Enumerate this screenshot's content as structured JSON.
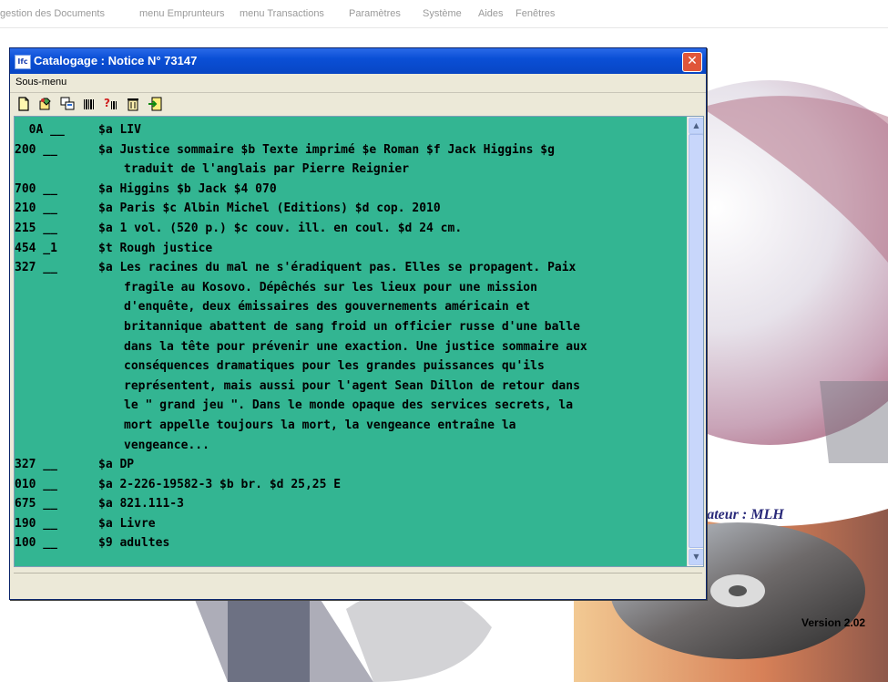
{
  "app_menu": [
    "gestion des Documents",
    "menu Emprunteurs",
    "menu Transactions",
    "Paramètres",
    "Système",
    "Aides",
    "Fenêtres"
  ],
  "window": {
    "icon_text": "Ifc",
    "title": "Catalogage : Notice N° 73147",
    "close": "✕",
    "submenu": "Sous-menu"
  },
  "toolbar": [
    {
      "icon": "new-page-icon"
    },
    {
      "icon": "edit-record-icon"
    },
    {
      "icon": "copy-record-icon"
    },
    {
      "icon": "barcode-icon"
    },
    {
      "icon": "barcode-help-icon"
    },
    {
      "icon": "delete-icon"
    },
    {
      "icon": "exit-icon"
    }
  ],
  "record": [
    {
      "tag": "  0A __ ",
      "lines": [
        "$a LIV"
      ]
    },
    {
      "tag": "200 __ ",
      "lines": [
        "$a Justice sommaire $b Texte imprimé $e Roman $f Jack Higgins $g",
        "traduit de l'anglais par Pierre Reignier"
      ]
    },
    {
      "tag": "700 __ ",
      "lines": [
        "$a Higgins $b Jack $4 070"
      ]
    },
    {
      "tag": "210 __ ",
      "lines": [
        "$a Paris $c Albin Michel (Editions) $d cop. 2010"
      ]
    },
    {
      "tag": "215 __ ",
      "lines": [
        "$a 1 vol. (520 p.) $c couv. ill. en coul. $d 24 cm."
      ]
    },
    {
      "tag": "454 _1 ",
      "lines": [
        "$t Rough justice"
      ]
    },
    {
      "tag": "327 __ ",
      "lines": [
        "$a Les racines du mal ne s'éradiquent pas. Elles se propagent. Paix",
        "fragile au Kosovo. Dépêchés sur les lieux pour une mission",
        "d'enquête, deux émissaires des gouvernements américain et",
        "britannique abattent de sang froid un officier russe d'une balle",
        "dans la tête pour prévenir une exaction. Une justice sommaire aux",
        "conséquences dramatiques pour les grandes puissances qu'ils",
        "représentent, mais aussi pour l'agent Sean Dillon de retour dans",
        "le \" grand jeu \". Dans le monde opaque des services secrets, la",
        "mort appelle toujours la mort, la vengeance entraîne la",
        "vengeance..."
      ]
    },
    {
      "tag": "327 __ ",
      "lines": [
        "$a DP"
      ]
    },
    {
      "tag": "010 __ ",
      "lines": [
        "$a 2-226-19582-3 $b br. $d 25,25 E"
      ]
    },
    {
      "tag": "675 __ ",
      "lines": [
        "$a 821.111-3"
      ]
    },
    {
      "tag": "190 __ ",
      "lines": [
        "$a Livre"
      ]
    },
    {
      "tag": "100 __ ",
      "lines": [
        "$9 adultes"
      ]
    }
  ],
  "background": {
    "user_label": "sateur : MLH",
    "version_label": "Version 2.02"
  },
  "colors": {
    "content_bg": "#33b592",
    "title_bar": "#0a4fd6"
  }
}
